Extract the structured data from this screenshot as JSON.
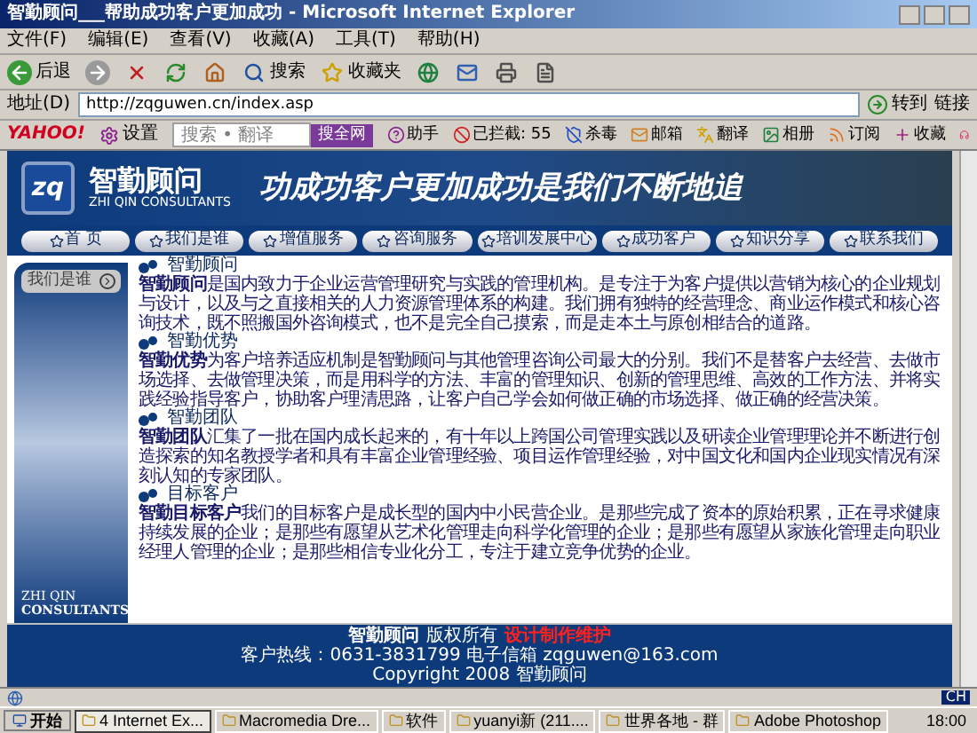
{
  "window": {
    "title": "智勤顾问___帮助成功客户更加成功 - Microsoft Internet Explorer"
  },
  "menu": [
    "文件(F)",
    "编辑(E)",
    "查看(V)",
    "收藏(A)",
    "工具(T)",
    "帮助(H)"
  ],
  "toolbar": [
    {
      "kind": "back",
      "label": "后退"
    },
    {
      "kind": "forward"
    },
    {
      "kind": "stop"
    },
    {
      "kind": "refresh"
    },
    {
      "kind": "home"
    },
    {
      "kind": "search",
      "label": "搜索"
    },
    {
      "kind": "favorites",
      "label": "收藏夹"
    },
    {
      "kind": "media"
    },
    {
      "kind": "mail"
    },
    {
      "kind": "print"
    },
    {
      "kind": "edit"
    }
  ],
  "address": {
    "label": "地址(D)",
    "url": "http://zqguwen.cn/index.asp",
    "go": "转到",
    "links": "链接"
  },
  "yahoo_bar": {
    "logo": "YAHOO!",
    "settings": "设置",
    "search_placeholder": "搜索 • 翻译",
    "search_button": "搜全网",
    "items": [
      {
        "kind": "helper",
        "label": "助手"
      },
      {
        "kind": "blocked",
        "label": "已拦截: 55"
      },
      {
        "kind": "antivirus",
        "label": "杀毒"
      },
      {
        "kind": "mail",
        "label": "邮箱"
      },
      {
        "kind": "translate",
        "label": "翻译"
      },
      {
        "kind": "album",
        "label": "相册"
      },
      {
        "kind": "rss",
        "label": "订阅"
      },
      {
        "kind": "favorite",
        "label": "收藏"
      }
    ]
  },
  "banner": {
    "logo_mark": "zq",
    "logo_name": "智勤顾问",
    "logo_sub": "ZHI QIN CONSULTANTS",
    "slogan": "功成功客户更加成功是我们不断地追"
  },
  "nav": [
    "首 页",
    "我们是谁",
    "增值服务",
    "咨询服务",
    "培训发展中心",
    "成功客户",
    "知识分享",
    "联系我们"
  ],
  "sidebar": {
    "button": "我们是谁",
    "brand_top": "ZHI QIN",
    "brand_bottom": "CONSULTANTS"
  },
  "sections": [
    {
      "title": "智勤顾问",
      "text": "**智勤顾问**是国内致力于企业运营管理研究与实践的管理机构。是专注于为客户提供以营销为核心的企业规划与设计，以及与之直接相关的人力资源管理体系的构建。我们拥有独特的经营理念、商业运作模式和核心咨询技术，既不照搬国外咨询模式，也不是完全自己摸索，而是走本土与原创相结合的道路。"
    },
    {
      "title": "智勤优势",
      "text": "**智勤优势**为客户培养适应机制是智勤顾问与其他管理咨询公司最大的分别。我们不是替客户去经营、去做市场选择、去做管理决策，而是用科学的方法、丰富的管理知识、创新的管理思维、高效的工作方法、并将实践经验指导客户，协助客户理清思路，让客户自己学会如何做正确的市场选择、做正确的经营决策。"
    },
    {
      "title": "智勤团队",
      "text": "**智勤团队**汇集了一批在国内成长起来的，有十年以上跨国公司管理实践以及研读企业管理理论并不断进行创造探索的知名教授学者和具有丰富企业管理经验、项目运作管理经验，对中国文化和国内企业现实情况有深刻认知的专家团队。"
    },
    {
      "title": "目标客户",
      "text": "**智勤目标客户**我们的目标客户是成长型的国内中小民营企业。是那些完成了资本的原始积累，正在寻求健康持续发展的企业；是那些有愿望从艺术化管理走向科学化管理的企业；是那些有愿望从家族化管理走向职业经理人管理的企业；是那些相信专业化分工，专注于建立竞争优势的企业。"
    }
  ],
  "footer": {
    "brand": "智勤顾问",
    "rights": "版权所有",
    "maker": "设计制作维护",
    "contact": "客户热线：0631-3831799 电子信箱 zqguwen@163.com",
    "copyright": "Copyright 2008 智勤顾问"
  },
  "status_bar": {
    "ime": "CH"
  },
  "taskbar": {
    "start": "开始",
    "tasks": [
      {
        "label": "4 Internet Ex...",
        "selected": true
      },
      {
        "label": "Macromedia Dre...",
        "selected": false
      },
      {
        "label": "软件",
        "selected": false
      },
      {
        "label": "yuanyi新 (211....",
        "selected": false
      },
      {
        "label": "世界各地 - 群",
        "selected": false
      },
      {
        "label": "Adobe Photoshop",
        "selected": false
      }
    ],
    "clock": "18:00"
  }
}
